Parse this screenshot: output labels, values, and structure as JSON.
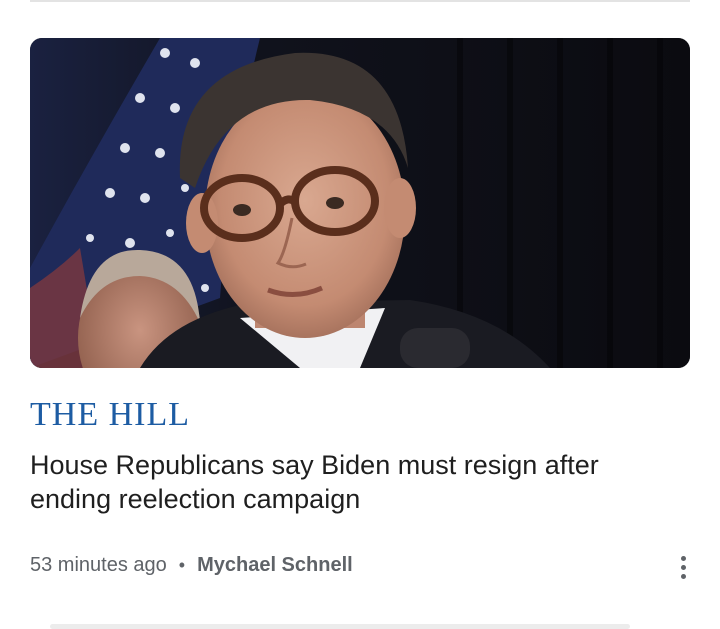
{
  "article": {
    "publisher": "THE HILL",
    "headline": "House Republicans say Biden must resign after ending reelection campaign",
    "time_ago": "53 minutes ago",
    "separator": "•",
    "author": "Mychael Schnell"
  },
  "icons": {
    "more": "more-vert-icon"
  },
  "colors": {
    "publisher": "#1d5ca3",
    "headline": "#1f1f1f",
    "meta": "#5f6368"
  }
}
